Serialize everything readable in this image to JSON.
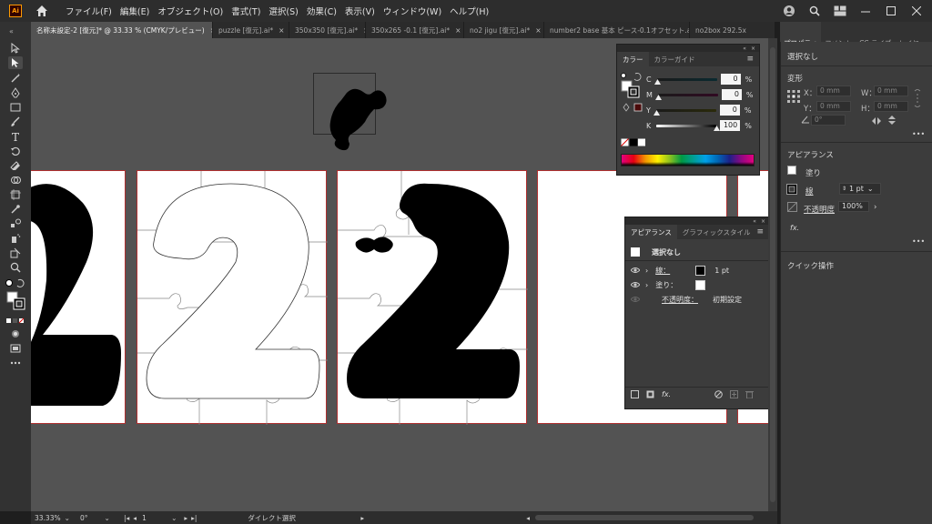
{
  "app": {
    "logo_text": "Ai"
  },
  "menu": [
    "ファイル(F)",
    "編集(E)",
    "オブジェクト(O)",
    "書式(T)",
    "選択(S)",
    "効果(C)",
    "表示(V)",
    "ウィンドウ(W)",
    "ヘルプ(H)"
  ],
  "tabs": [
    {
      "label": "名称未設定-2 [復元]* @ 33.33 % (CMYK/プレビュー)",
      "active": true
    },
    {
      "label": "puzzle [復元].ai*",
      "active": false
    },
    {
      "label": "350x350 [復元].ai*",
      "active": false
    },
    {
      "label": "350x265 -0.1 [復元].ai*",
      "active": false
    },
    {
      "label": "no2 jigu [復元].ai*",
      "active": false
    },
    {
      "label": "number2  base  基本  ピース-0.1オフセット.ai*",
      "active": false
    },
    {
      "label": "no2box 292.5x",
      "active": false
    }
  ],
  "status": {
    "zoom": "33.33%",
    "rotation": "0°",
    "artboard_num": "1",
    "tool_name": "ダイレクト選択"
  },
  "color_panel": {
    "tabs": [
      "カラー",
      "カラーガイド"
    ],
    "channels": [
      {
        "label": "C",
        "value": "0"
      },
      {
        "label": "M",
        "value": "0"
      },
      {
        "label": "Y",
        "value": "0"
      },
      {
        "label": "K",
        "value": "100"
      }
    ],
    "percent": "%"
  },
  "appearance_panel": {
    "tabs": [
      "アピアランス",
      "グラフィックスタイル"
    ],
    "title": "選択なし",
    "stroke_label": "線：",
    "stroke_value": "1 pt",
    "fill_label": "塗り：",
    "opacity_label": "不透明度：",
    "opacity_value": "初期設定",
    "fx": "fx."
  },
  "properties": {
    "tabs": [
      "プロパティ",
      "コメント",
      "CC ライブ",
      "レイヤー"
    ],
    "selection": "選択なし",
    "transform_title": "変形",
    "x_label": "X：",
    "x_value": "0 mm",
    "y_label": "Y：",
    "y_value": "0 mm",
    "w_label": "W：",
    "w_value": "0 mm",
    "h_label": "H：",
    "h_value": "0 mm",
    "angle_value": "0°",
    "appearance_title": "アピアランス",
    "fill_label": "塗り",
    "stroke_label": "線",
    "stroke_weight": "1 pt",
    "opacity_label": "不透明度",
    "opacity_value": "100%",
    "fx": "fx.",
    "quick_actions": "クイック操作",
    "more": "•••"
  }
}
